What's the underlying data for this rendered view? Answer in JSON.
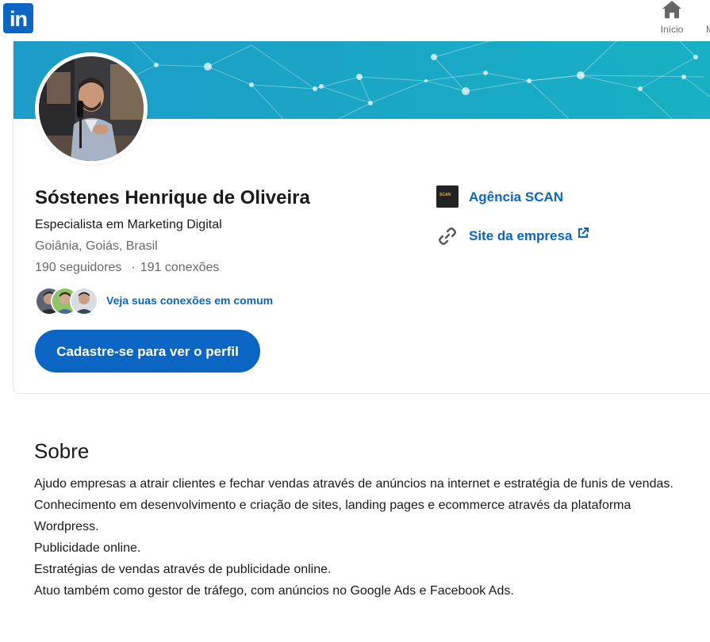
{
  "nav": {
    "logo_text": "in",
    "home_label": "Início",
    "cut_label": "M"
  },
  "profile": {
    "name": "Sóstenes Henrique de Oliveira",
    "headline": "Especialista em Marketing Digital",
    "location": "Goiânia, Goiás, Brasil",
    "followers": "190 seguidores",
    "separator": "·",
    "connections": "191 conexões",
    "mutual_link": "Veja suas conexões em comum",
    "cta_label": "Cadastre-se para ver o perfil"
  },
  "company": {
    "name": "Agência SCAN",
    "logo_text": "SCAN",
    "site_label": "Site da empresa"
  },
  "about": {
    "title": "Sobre",
    "lines": [
      "Ajudo empresas a atrair clientes e fechar vendas através de anúncios na internet e estratégia de funis de vendas.",
      "Conhecimento em desenvolvimento e criação de sites, landing pages e ecommerce através da plataforma Wordpress.",
      "Publicidade online.",
      "Estratégias de vendas através de publicidade online.",
      "Atuo também como gestor de tráfego, com anúncios no Google Ads e Facebook Ads."
    ]
  },
  "colors": {
    "brand": "#0a66c2",
    "cover": "#1aa3c4"
  },
  "icons": [
    "linkedin-logo",
    "home-icon",
    "link-icon",
    "external-link-icon"
  ]
}
